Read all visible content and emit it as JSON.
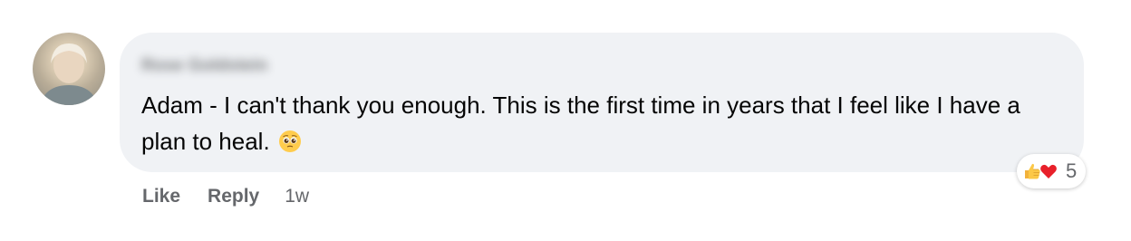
{
  "comment": {
    "author": "Rose Goldstein",
    "text": "Adam - I can't thank you enough. This is the first time in years that I feel like I have a plan to heal.",
    "trailing_emoji": "pleading-face-emoji"
  },
  "reactions": {
    "icons": [
      "thumbs-up-icon",
      "heart-icon"
    ],
    "count": "5"
  },
  "actions": {
    "like_label": "Like",
    "reply_label": "Reply",
    "timestamp": "1w"
  },
  "colors": {
    "bubble_bg": "#f0f2f5",
    "text": "#050505",
    "meta_text": "#65676b",
    "like_blue": "#1877f2",
    "heart_red": "#f33e58"
  }
}
